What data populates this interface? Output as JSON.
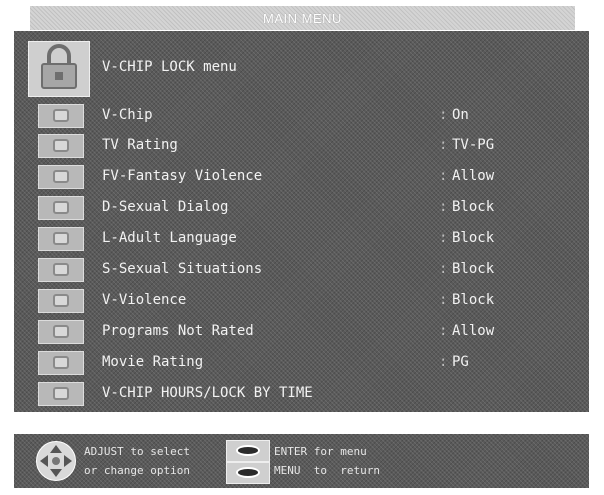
{
  "tab": {
    "title": "MAIN MENU"
  },
  "header": {
    "title": "V-CHIP LOCK menu",
    "icon": "lock-icon"
  },
  "menu": {
    "items": [
      {
        "label": "V-Chip",
        "colon": ":",
        "value": "On",
        "icon": "tv-icon"
      },
      {
        "label": "TV Rating",
        "colon": ":",
        "value": "TV-PG",
        "icon": "tv-icon"
      },
      {
        "label": "FV-Fantasy Violence",
        "colon": ":",
        "value": "Allow",
        "icon": "tv-icon"
      },
      {
        "label": "D-Sexual Dialog",
        "colon": ":",
        "value": "Block",
        "icon": "tv-icon"
      },
      {
        "label": "L-Adult Language",
        "colon": ":",
        "value": "Block",
        "icon": "tv-icon"
      },
      {
        "label": "S-Sexual Situations",
        "colon": ":",
        "value": "Block",
        "icon": "tv-icon"
      },
      {
        "label": "V-Violence",
        "colon": ":",
        "value": "Block",
        "icon": "tv-icon"
      },
      {
        "label": "Programs Not Rated",
        "colon": ":",
        "value": "Allow",
        "icon": "tv-icon"
      },
      {
        "label": "Movie Rating",
        "colon": ":",
        "value": "PG",
        "icon": "tv-icon"
      },
      {
        "label": "V-CHIP HOURS/LOCK BY TIME",
        "colon": "",
        "value": "",
        "icon": "tv-icon"
      }
    ]
  },
  "help": {
    "adjust_line1": "ADJUST to select",
    "adjust_line2": "or change option",
    "enter_line": "ENTER for menu",
    "menu_line": "MENU  to  return",
    "dpad_icon": "dpad-icon",
    "enter_icon": "enter-button-icon",
    "menu_icon": "menu-button-icon"
  },
  "colors": {
    "panel": "#5a5a5a",
    "text": "#f2f2f2",
    "tab": "#d4d4d4"
  }
}
